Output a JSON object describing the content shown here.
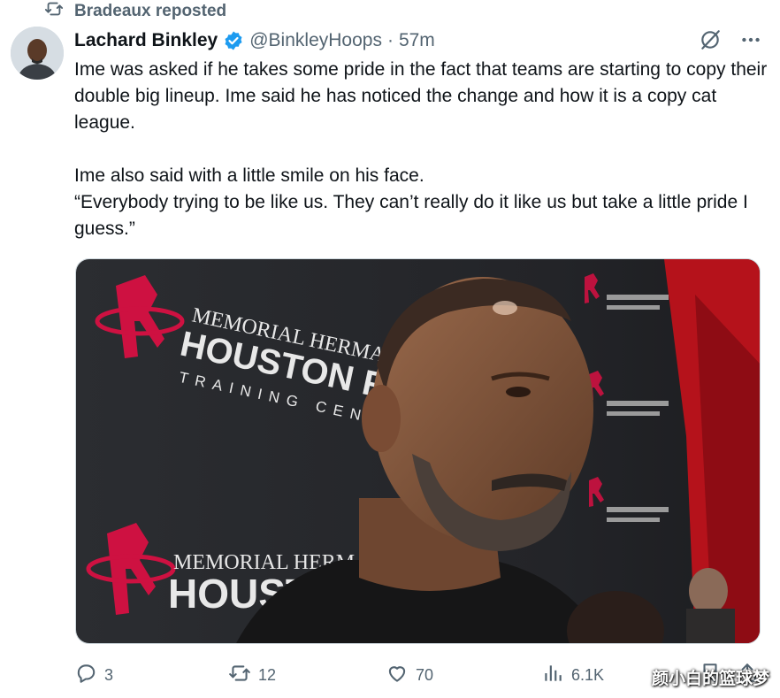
{
  "repost": {
    "label": "Bradeaux reposted",
    "icon": "repost-icon"
  },
  "author": {
    "name": "Lachard Binkley",
    "handle": "@BinkleyHoops",
    "separator": "·",
    "time": "57m",
    "verified_icon": "verified-badge-icon"
  },
  "header_actions": {
    "grok_icon": "grok-icon",
    "more_icon": "more-icon"
  },
  "tweet": {
    "paragraph1": "Ime was asked if he takes some pride in the fact that teams are starting to copy their double big lineup. Ime said he has noticed the change and how it is a copy cat league.",
    "paragraph2_line1": "Ime also said with a little smile on his face.",
    "paragraph2_line2": "“Everybody trying to be like us. They can’t  really do it like us but take a little pride I guess.”"
  },
  "media": {
    "backdrop_top": {
      "line1": "MEMORIAL HERMANN",
      "line2": "HOUSTON ROCKETS",
      "line3": "TRAINING CENTER"
    },
    "backdrop_bottom": {
      "line1": "MEMORIAL HERMANN",
      "line2": "HOUSTON"
    }
  },
  "stats": {
    "replies": "3",
    "reposts": "12",
    "likes": "70",
    "views": "6.1K"
  },
  "watermark": "颜小白的篮球梦",
  "colors": {
    "accent": "#1d9bf0",
    "muted": "#536471",
    "rockets_red": "#ce1141"
  }
}
